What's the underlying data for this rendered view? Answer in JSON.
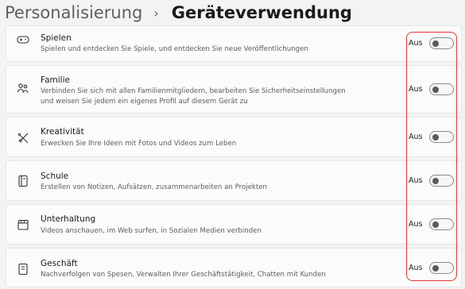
{
  "breadcrumb": {
    "parent": "Personalisierung",
    "separator": "›",
    "current": "Geräteverwendung"
  },
  "items": [
    {
      "title": "Spielen",
      "description": "Spielen und entdecken Sie Spiele, und entdecken Sie neue Veröffentlichungen",
      "state": "Aus",
      "icon": "gamepad-icon"
    },
    {
      "title": "Familie",
      "description": "Verbinden Sie sich mit allen Familienmitgliedern, bearbeiten Sie Sicherheitseinstellungen und weisen Sie jedem ein eigenes Profil auf diesem Gerät zu",
      "state": "Aus",
      "icon": "family-icon"
    },
    {
      "title": "Kreativität",
      "description": "Erwecken Sie Ihre Ideen mit Fotos und Videos zum Leben",
      "state": "Aus",
      "icon": "creativity-icon"
    },
    {
      "title": "Schule",
      "description": "Erstellen von Notizen, Aufsätzen, zusammenarbeiten an Projekten",
      "state": "Aus",
      "icon": "notebook-icon"
    },
    {
      "title": "Unterhaltung",
      "description": "Videos anschauen, im Web surfen, in Sozialen Medien verbinden",
      "state": "Aus",
      "icon": "clapperboard-icon"
    },
    {
      "title": "Geschäft",
      "description": "Nachverfolgen von Spesen, Verwalten Ihrer Geschäftstätigkeit, Chatten mit Kunden",
      "state": "Aus",
      "icon": "briefcase-icon"
    }
  ],
  "colors": {
    "highlight": "#e53935",
    "card_background": "#fbfbfb",
    "page_background": "#f3f3f3"
  }
}
